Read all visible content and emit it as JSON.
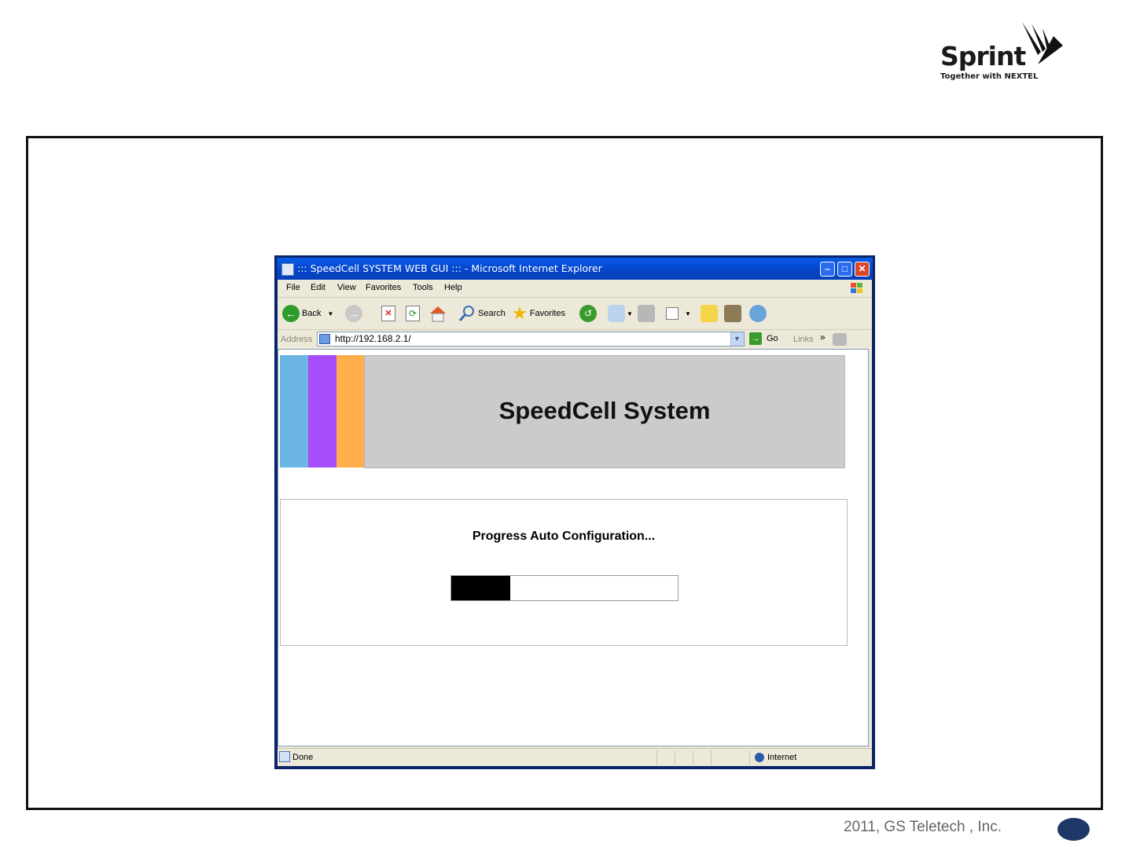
{
  "logo": {
    "brand": "Sprint",
    "tagline": "Together with NEXTEL"
  },
  "browser": {
    "window_title": "::: SpeedCell SYSTEM WEB GUI ::: - Microsoft Internet Explorer",
    "menu": [
      "File",
      "Edit",
      "View",
      "Favorites",
      "Tools",
      "Help"
    ],
    "toolbar": {
      "back": "Back",
      "search": "Search",
      "favorites": "Favorites"
    },
    "address_label": "Address",
    "address": "http://192.168.2.1/",
    "go": "Go",
    "links": "Links",
    "status": "Done",
    "zone": "Internet"
  },
  "page": {
    "title": "SpeedCell System",
    "band_colors": [
      "#6bb6e4",
      "#a64dfa",
      "#ffae4a"
    ],
    "progress_label": "Progress Auto Configuration...",
    "progress_fraction": 0.26
  },
  "footer": {
    "copyright": "2011, GS Teletech , Inc."
  }
}
